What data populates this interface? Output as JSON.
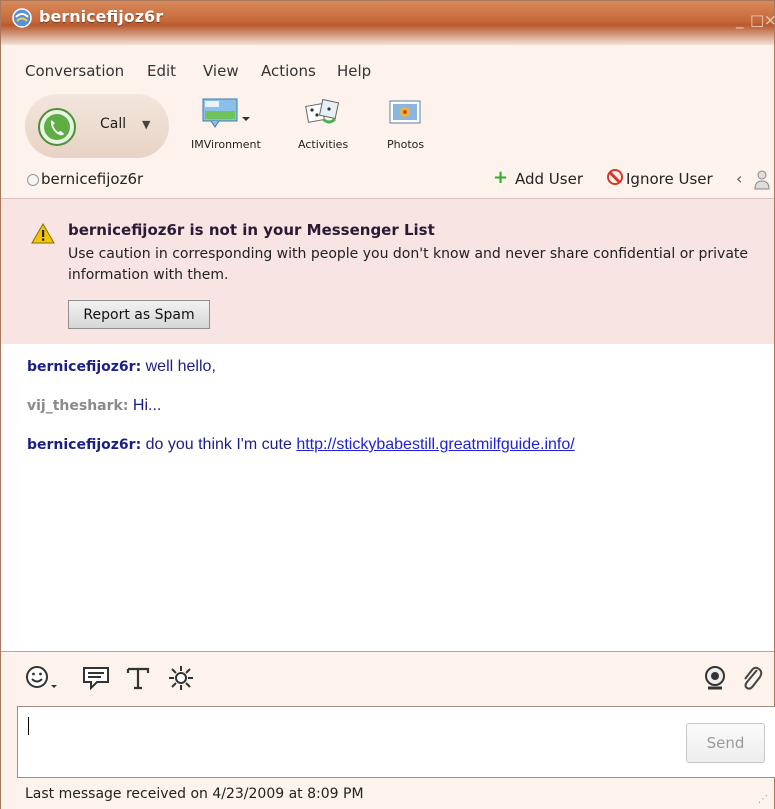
{
  "window": {
    "title": "bernicefijoz6r"
  },
  "menu": [
    "Conversation",
    "Edit",
    "View",
    "Actions",
    "Help"
  ],
  "toolbar": {
    "call_label": "Call",
    "imvironment_label": "IMVironment",
    "activities_label": "Activities",
    "photos_label": "Photos"
  },
  "userbar": {
    "contact": "bernicefijoz6r",
    "add_user": "Add User",
    "ignore_user": "Ignore User"
  },
  "warning": {
    "heading": "bernicefijoz6r is not in your Messenger List",
    "body": "Use caution in corresponding with people you don't know and never share confidential or private information with them.",
    "spam_button": "Report as Spam"
  },
  "messages": [
    {
      "sender": "bernicefijoz6r:",
      "text": "well hello,",
      "link": ""
    },
    {
      "sender": "vij_theshark:",
      "text": "Hi...",
      "link": ""
    },
    {
      "sender": "bernicefijoz6r:",
      "text": "do you think I'm cute",
      "link": "http://stickybabestill.greatmilfguide.info/"
    }
  ],
  "compose": {
    "send_label": "Send"
  },
  "status": {
    "text": "Last message received on 4/23/2009 at 8:09 PM"
  },
  "colors": {
    "accent": "#c6683a",
    "warning_bg": "#f7e4e3",
    "sender": "#1b1e86",
    "link": "#1f21d6"
  }
}
